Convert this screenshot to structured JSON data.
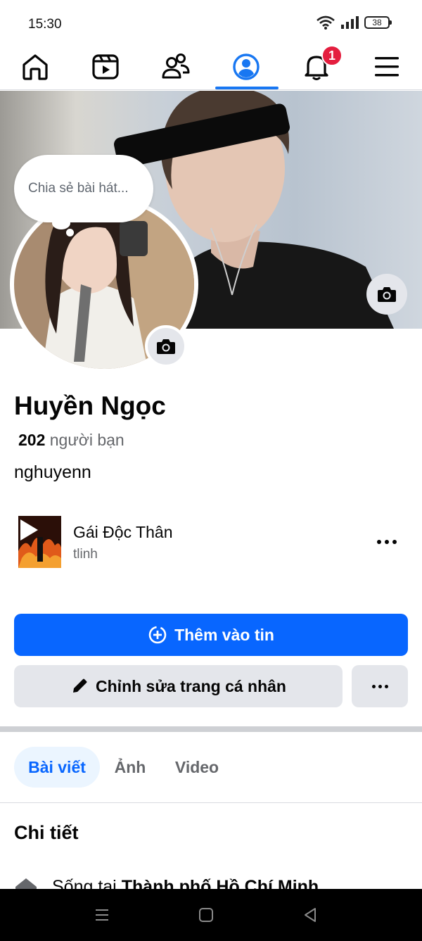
{
  "status_bar": {
    "time": "15:30",
    "battery": "38"
  },
  "top_nav": {
    "items": [
      {
        "name": "home",
        "icon": "home-icon"
      },
      {
        "name": "video",
        "icon": "video-icon"
      },
      {
        "name": "friends",
        "icon": "friends-icon"
      },
      {
        "name": "profile",
        "icon": "profile-icon",
        "active": true
      },
      {
        "name": "notifications",
        "icon": "bell-icon",
        "badge": "1"
      },
      {
        "name": "menu",
        "icon": "menu-icon"
      }
    ],
    "notification_badge": "1",
    "accent_color": "#1877f2"
  },
  "profile": {
    "note_placeholder": "Chia sẻ bài hát...",
    "name": "Huyền Ngọc",
    "friends_count": "202",
    "friends_label": "người bạn",
    "bio": "nghuyenn"
  },
  "music": {
    "title": "Gái Độc Thân",
    "artist": "tlinh"
  },
  "actions": {
    "add_story_label": "Thêm vào tin",
    "edit_profile_label": "Chỉnh sửa trang cá nhân",
    "primary_color": "#0866ff"
  },
  "tabs": [
    {
      "label": "Bài viết",
      "active": true
    },
    {
      "label": "Ảnh",
      "active": false
    },
    {
      "label": "Video",
      "active": false
    }
  ],
  "details": {
    "title": "Chi tiết",
    "lives_in_prefix": "Sống tại",
    "lives_in_place": "Thành phố Hồ Chí Minh"
  }
}
